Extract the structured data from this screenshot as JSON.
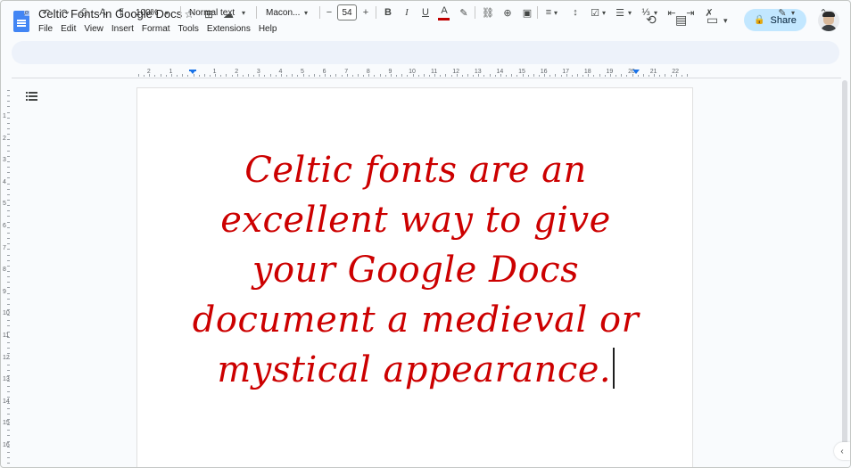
{
  "title": "Celtic Fonts in Google Docs",
  "title_icons": {
    "star": "☆",
    "move": "⊞",
    "cloud": "☁"
  },
  "menu": [
    "File",
    "Edit",
    "View",
    "Insert",
    "Format",
    "Tools",
    "Extensions",
    "Help"
  ],
  "right_tools": {
    "history": "⟲",
    "comments": "▤",
    "meet": "▭",
    "meet_caret": "▾"
  },
  "share": {
    "label": "Share",
    "lock": "🔒"
  },
  "toolbar": {
    "search": "⌕",
    "undo": "↶",
    "redo": "↷",
    "print": "⎙",
    "spell": "A",
    "paint": "¶",
    "zoom": "100%",
    "style": "Normal text",
    "font": "Macon...",
    "minus": "−",
    "font_size": "54",
    "plus": "+",
    "bold": "B",
    "italic": "I",
    "underline": "U",
    "text_color": "A",
    "highlight": "✎",
    "link": "⛓",
    "comment": "⊕",
    "image": "▣",
    "align": "≡",
    "line_spacing": "↕",
    "checklist": "☑",
    "bullets": "☰",
    "numbered": "⅓",
    "indent_less": "⇤",
    "indent_more": "⇥",
    "clear_format": "✗",
    "edit_mode": "✎",
    "caret": "▾",
    "collapse": "⌃"
  },
  "ruler_numbers": [
    "2",
    "1",
    "1",
    "2",
    "3",
    "4",
    "5",
    "6",
    "7",
    "8",
    "9",
    "10",
    "11",
    "12",
    "13",
    "14",
    "15",
    "16",
    "17",
    "18",
    "19",
    "20",
    "21",
    "22"
  ],
  "vruler_numbers": [
    "1",
    "2",
    "3",
    "4",
    "5",
    "6",
    "7",
    "8",
    "9",
    "10",
    "11",
    "12",
    "13",
    "14",
    "15",
    "16"
  ],
  "document": {
    "lines": [
      "Celtic fonts are an",
      "excellent way to give",
      "your Google Docs",
      "document a medieval or",
      "mystical appearance."
    ],
    "text_color": "#cc0000"
  },
  "side_toggle": "‹"
}
